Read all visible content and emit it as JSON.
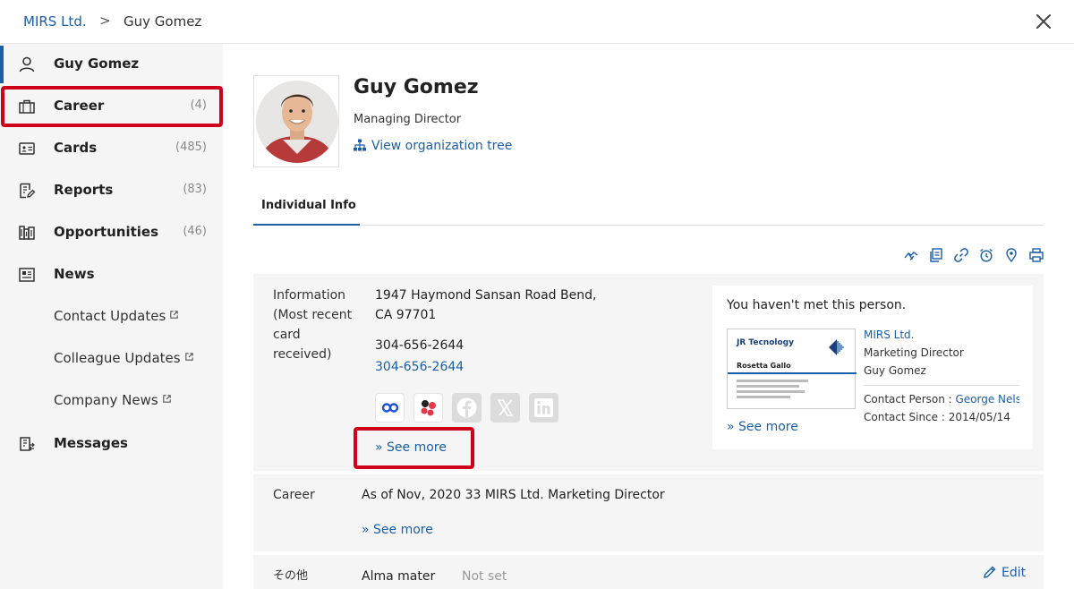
{
  "breadcrumb": {
    "root": "MIRS Ltd.",
    "separator": ">",
    "current": "Guy Gomez"
  },
  "sidebar": {
    "items": [
      {
        "label": "Guy Gomez",
        "count": "",
        "icon": "person-icon"
      },
      {
        "label": "Career",
        "count": "(4)",
        "icon": "briefcase-icon"
      },
      {
        "label": "Cards",
        "count": "(485)",
        "icon": "card-icon"
      },
      {
        "label": "Reports",
        "count": "(83)",
        "icon": "report-icon"
      },
      {
        "label": "Opportunities",
        "count": "(46)",
        "icon": "opportunities-icon"
      },
      {
        "label": "News",
        "count": "",
        "icon": "news-icon"
      },
      {
        "label": "Contact Updates",
        "count": "",
        "icon": "external-link-icon"
      },
      {
        "label": "Colleague Updates",
        "count": "",
        "icon": "external-link-icon"
      },
      {
        "label": "Company News",
        "count": "",
        "icon": "external-link-icon"
      },
      {
        "label": "Messages",
        "count": "",
        "icon": "messages-icon"
      }
    ]
  },
  "profile": {
    "name": "Guy Gomez",
    "title": "Managing Director",
    "org_link": "View organization tree"
  },
  "tabs": [
    {
      "label": "Individual Info"
    }
  ],
  "toolbar": {
    "icons": [
      "handshake-icon",
      "copy-icon",
      "link-icon",
      "alarm-icon",
      "location-icon",
      "print-icon"
    ]
  },
  "info": {
    "label": "Information (Most recent card received)",
    "address": "1947 Haymond Sansan Road Bend, CA 97701",
    "phone1": "304-656-2644",
    "phone2": "304-656-2644",
    "see_more": "» See more",
    "social": [
      "eight-app-icon",
      "dots-app-icon",
      "facebook-icon",
      "x-icon",
      "linkedin-icon"
    ]
  },
  "met": {
    "text": "You haven't met this person.",
    "card": {
      "company": "JR Tecnology",
      "person": "Rosetta Gallo"
    },
    "company": "MIRS Ltd.",
    "title": "Marketing Director",
    "name": "Guy Gomez",
    "contact_person_label": "Contact Person : ",
    "contact_person": "George Nelson",
    "contact_since": "Contact Since : 2014/05/14",
    "see_more": "» See more"
  },
  "career": {
    "label": "Career",
    "value": "As of Nov, 2020 33 MIRS Ltd. Marketing Director",
    "see_more": "» See more"
  },
  "other": {
    "label": "その他",
    "alma_label": "Alma mater",
    "alma_value": "Not set",
    "edit": "Edit"
  },
  "colors": {
    "accent": "#1a5fa8",
    "highlight": "#d0021b",
    "panel_bg": "#f5f5f5"
  }
}
